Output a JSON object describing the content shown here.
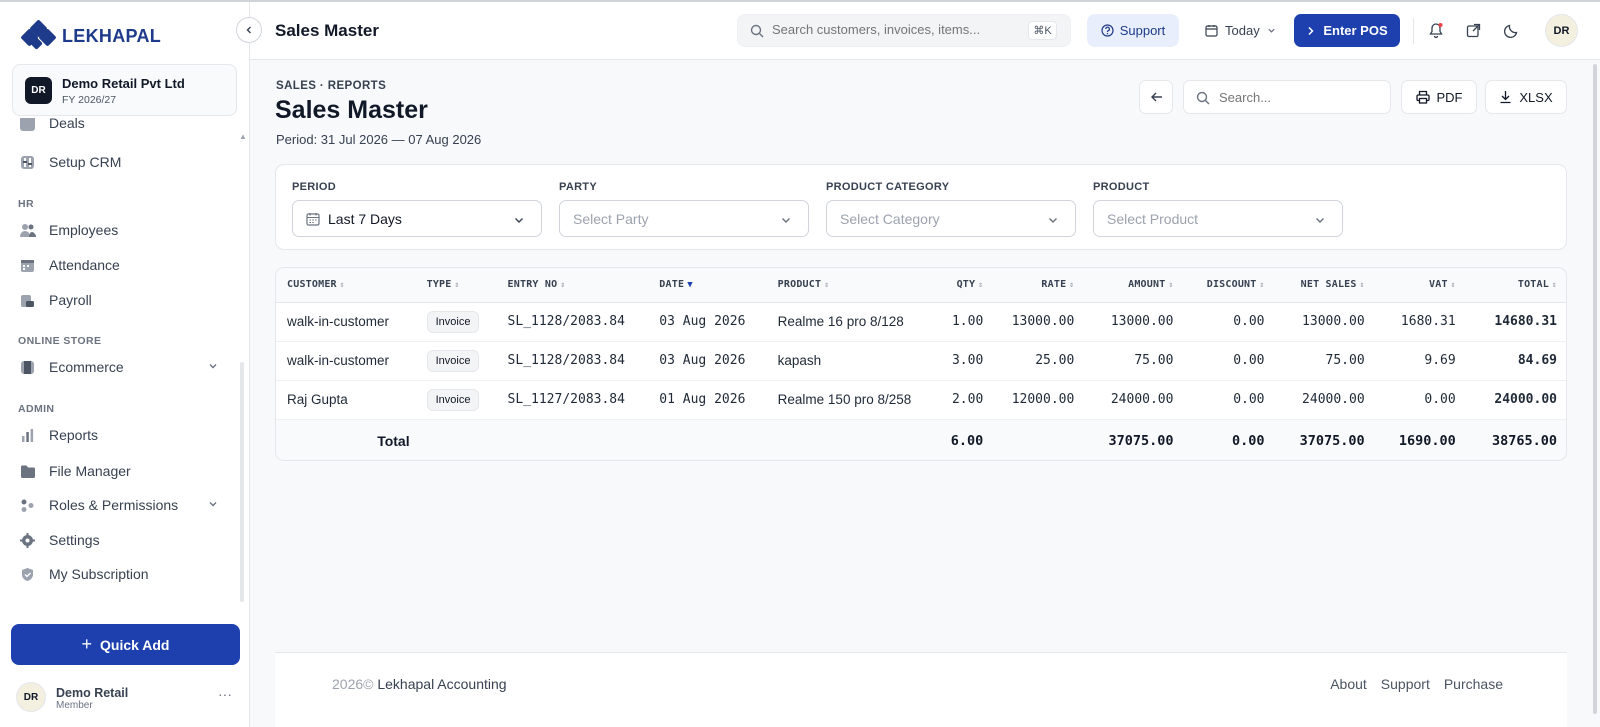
{
  "brand": {
    "name": "LEKHAPAL"
  },
  "company": {
    "badge": "DR",
    "name": "Demo Retail Pvt Ltd",
    "fy": "FY 2026/27"
  },
  "sidebar": {
    "items_top": [
      {
        "label": "Deals",
        "icon": "deals-icon"
      },
      {
        "label": "Setup CRM",
        "icon": "setup-crm-icon"
      }
    ],
    "sections": {
      "hr": "HR",
      "online_store": "ONLINE STORE",
      "admin": "ADMIN"
    },
    "hr_items": [
      {
        "label": "Employees",
        "icon": "users-icon"
      },
      {
        "label": "Attendance",
        "icon": "calendar-icon"
      },
      {
        "label": "Payroll",
        "icon": "payroll-icon"
      }
    ],
    "store_items": [
      {
        "label": "Ecommerce",
        "icon": "store-icon"
      }
    ],
    "admin_items": [
      {
        "label": "Reports",
        "icon": "bar-chart-icon"
      },
      {
        "label": "File Manager",
        "icon": "folder-icon"
      },
      {
        "label": "Roles & Permissions",
        "icon": "roles-icon"
      },
      {
        "label": "Settings",
        "icon": "gear-icon"
      },
      {
        "label": "My Subscription",
        "icon": "shield-icon"
      }
    ],
    "quick_add": "Quick Add",
    "user": {
      "initials": "DR",
      "name": "Demo Retail",
      "role": "Member"
    }
  },
  "header": {
    "title": "Sales Master",
    "search_placeholder": "Search customers, invoices, items...",
    "search_kbd": "⌘K",
    "support": "Support",
    "today": "Today",
    "enter_pos": "Enter POS",
    "avatar": "DR"
  },
  "page": {
    "breadcrumb": "SALES · REPORTS",
    "title": "Sales Master",
    "period": "Period: 31 Jul 2026 — 07 Aug 2026",
    "search_placeholder": "Search...",
    "pdf": "PDF",
    "xlsx": "XLSX"
  },
  "filters": {
    "period": {
      "label": "PERIOD",
      "value": "Last 7 Days"
    },
    "party": {
      "label": "PARTY",
      "placeholder": "Select Party"
    },
    "category": {
      "label": "PRODUCT CATEGORY",
      "placeholder": "Select Category"
    },
    "product": {
      "label": "PRODUCT",
      "placeholder": "Select Product"
    }
  },
  "table": {
    "columns": [
      "CUSTOMER",
      "TYPE",
      "ENTRY NO",
      "DATE",
      "PRODUCT",
      "QTY",
      "RATE",
      "AMOUNT",
      "DISCOUNT",
      "NET SALES",
      "VAT",
      "TOTAL"
    ],
    "rows": [
      {
        "customer": "walk-in-customer",
        "type": "Invoice",
        "entry": "SL_1128/2083.84",
        "date": "03 Aug 2026",
        "product": "Realme 16 pro 8/128",
        "qty": "1.00",
        "rate": "13000.00",
        "amount": "13000.00",
        "discount": "0.00",
        "net": "13000.00",
        "vat": "1680.31",
        "total": "14680.31"
      },
      {
        "customer": "walk-in-customer",
        "type": "Invoice",
        "entry": "SL_1128/2083.84",
        "date": "03 Aug 2026",
        "product": "kapash",
        "qty": "3.00",
        "rate": "25.00",
        "amount": "75.00",
        "discount": "0.00",
        "net": "75.00",
        "vat": "9.69",
        "total": "84.69"
      },
      {
        "customer": "Raj Gupta",
        "type": "Invoice",
        "entry": "SL_1127/2083.84",
        "date": "01 Aug 2026",
        "product": "Realme 150 pro 8/258",
        "qty": "2.00",
        "rate": "12000.00",
        "amount": "24000.00",
        "discount": "0.00",
        "net": "24000.00",
        "vat": "0.00",
        "total": "24000.00"
      }
    ],
    "totals": {
      "label": "Total",
      "qty": "6.00",
      "amount": "37075.00",
      "discount": "0.00",
      "net": "37075.00",
      "vat": "1690.00",
      "total": "38765.00"
    }
  },
  "footer": {
    "year": "2026©",
    "company": "Lekhapal Accounting",
    "links": [
      "About",
      "Support",
      "Purchase"
    ]
  },
  "colors": {
    "brand": "#1e3a8a",
    "primary": "#1e40af",
    "support_bg": "#e8eefb"
  }
}
